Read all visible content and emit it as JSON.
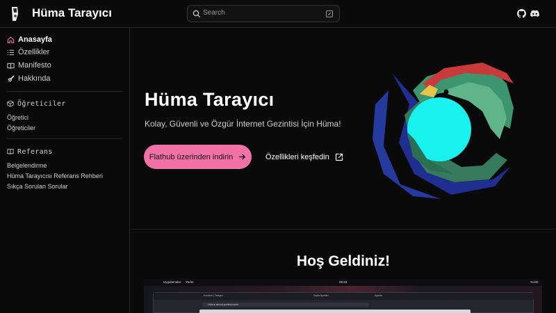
{
  "header": {
    "title": "Hüma Tarayıcı",
    "search_placeholder": "Search",
    "icons": [
      "github-icon",
      "discord-icon"
    ]
  },
  "sidebar": {
    "nav": [
      {
        "label": "Anasayfa",
        "icon": "home-icon",
        "active": true
      },
      {
        "label": "Özellikler",
        "icon": "list-icon"
      },
      {
        "label": "Manifesto",
        "icon": "book-open-icon"
      },
      {
        "label": "Hakkında",
        "icon": "rocket-icon"
      }
    ],
    "sections": [
      {
        "title": "Öğreticiler",
        "icon": "cube-icon",
        "links": [
          "Öğretici",
          "Öğreticiler"
        ]
      },
      {
        "title": "Referans",
        "icon": "book-icon",
        "links": [
          "Belgelendirme",
          "Hüma Tarayıcısı Referans Rehberi",
          "Sıkça Sorulan Sorular"
        ]
      }
    ]
  },
  "hero": {
    "title": "Hüma Tarayıcı",
    "tagline": "Kolay, Güvenli ve Özgür İnternet Gezintisi İçin Hüma!",
    "primary_button": "Flathub üzerinden indirin",
    "secondary_link": "Özellikleri keşfedin"
  },
  "welcome": {
    "title": "Hoş Geldiniz!"
  },
  "preview": {
    "topbar_left": [
      "Uygulamalar",
      "Yerler"
    ],
    "clock": "08:53",
    "battery": "%100",
    "url": "Hüma  about:preferences",
    "tabs": [
      "Kurulum | Tarayıcı",
      "Sayfa Ayarları",
      "Ayarlar"
    ]
  },
  "colors": {
    "accent": "#f272a8",
    "background": "#0a0a0a",
    "border": "#262626"
  }
}
